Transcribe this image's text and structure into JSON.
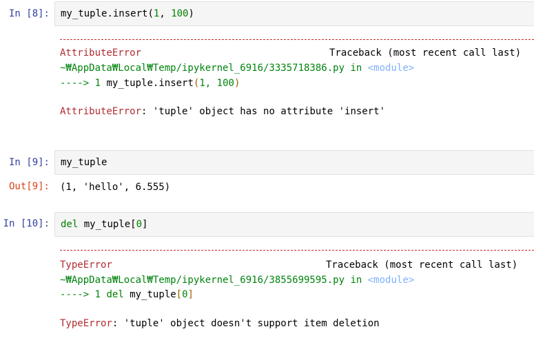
{
  "cells": [
    {
      "in_prompt": "In [8]:",
      "code_obj": "my_tuple",
      "code_method": ".insert",
      "code_paren_open": "(",
      "code_args_num1": "1",
      "code_args_sep": ", ",
      "code_args_num2": "100",
      "code_paren_close": ")",
      "error": {
        "dashes": "---------------------------------------------------------------------------",
        "name": "AttributeError",
        "traceback_label": "Traceback (most recent call last)",
        "path": "~₩AppData₩Local₩Temp/ipykernel_6916/3335718386.py",
        "in_word": "in",
        "module": "<module>",
        "arrow": "---->",
        "line_no": "1",
        "line_code_obj": "my_tuple",
        "line_code_method": ".insert",
        "line_paren_open": "(",
        "line_args": "1, 100",
        "line_paren_close": ")",
        "final_name": "AttributeError",
        "final_msg": ": 'tuple' object has no attribute 'insert'"
      }
    },
    {
      "in_prompt": "In [9]:",
      "code": "my_tuple",
      "out_prompt": "Out[9]:",
      "output": "(1, 'hello', 6.555)"
    },
    {
      "in_prompt": "In [10]:",
      "code_kw": "del",
      "code_rest": " my_tuple",
      "code_bracket_open": "[",
      "code_index": "0",
      "code_bracket_close": "]",
      "error": {
        "dashes": "---------------------------------------------------------------------------",
        "name": "TypeError",
        "traceback_label": "Traceback (most recent call last)",
        "path": "~₩AppData₩Local₩Temp/ipykernel_6916/3855699595.py",
        "in_word": "in",
        "module": "<module>",
        "arrow": "---->",
        "line_no": "1",
        "line_kw": "del",
        "line_rest": " my_tuple",
        "line_bracket_open": "[",
        "line_index": "0",
        "line_bracket_close": "]",
        "final_name": "TypeError",
        "final_msg": ": 'tuple' object doesn't support item deletion"
      }
    }
  ],
  "colors": {
    "in_prompt": "#303f9f",
    "out_prompt": "#d84315",
    "error_name": "#b22b31",
    "path_green": "#00830d",
    "module_blue": "#7fb0ff",
    "cell_bg": "#f5f5f5",
    "cell_border": "#e0e0e0"
  }
}
